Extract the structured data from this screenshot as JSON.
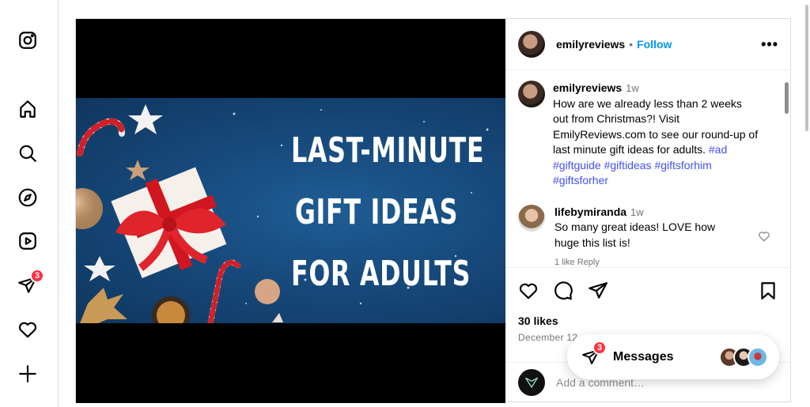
{
  "nav": {
    "items": [
      {
        "name": "instagram-logo-icon"
      },
      {
        "name": "home-icon"
      },
      {
        "name": "search-icon"
      },
      {
        "name": "explore-icon"
      },
      {
        "name": "reels-icon"
      },
      {
        "name": "direct-messages-icon",
        "badge": "3"
      },
      {
        "name": "notifications-heart-icon"
      },
      {
        "name": "create-plus-icon"
      }
    ]
  },
  "post": {
    "image_text": [
      "LAST-MINUTE",
      "GIFT IDEAS",
      "FOR ADULTS"
    ],
    "author": "emilyreviews",
    "separator": "•",
    "follow_label": "Follow",
    "more_label": "•••",
    "caption": {
      "username": "emilyreviews",
      "time": "1w",
      "text": "How are we already less than 2 weeks out from Christmas?! Visit EmilyReviews.com to see our round-up of last minute gift ideas for adults.",
      "hashtags": [
        "#ad",
        "#giftguide",
        "#giftideas",
        "#giftsforhim",
        "#giftsforher"
      ]
    },
    "comments": [
      {
        "username": "lifebymiranda",
        "time": "1w",
        "text": "So many great ideas! LOVE how huge this list is!",
        "meta": "1 like  Reply"
      }
    ],
    "likes": "30 likes",
    "date": "December 12",
    "add_comment_placeholder": "Add a comment…"
  },
  "messages_pill": {
    "label": "Messages",
    "badge": "3"
  },
  "colors": {
    "accent": "#0095f6",
    "badge": "#ff3040",
    "hashtag": "#4150f7"
  }
}
